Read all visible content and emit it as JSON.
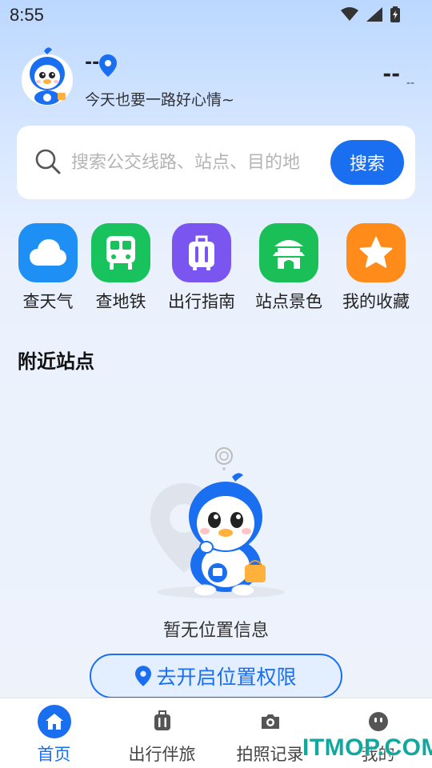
{
  "status_bar": {
    "time": "8:55"
  },
  "header": {
    "user_name": "--",
    "greeting": "今天也要一路好心情~",
    "weather_temp": "--",
    "weather_sub": "--"
  },
  "search": {
    "placeholder": "搜索公交线路、站点、目的地",
    "button_label": "搜索"
  },
  "quick_actions": [
    {
      "label": "查天气",
      "icon": "cloud-icon",
      "color": "#1e8ff5"
    },
    {
      "label": "查地铁",
      "icon": "subway-icon",
      "color": "#18c25c"
    },
    {
      "label": "出行指南",
      "icon": "luggage-icon",
      "color": "#7b55f0"
    },
    {
      "label": "站点景色",
      "icon": "pavilion-icon",
      "color": "#1bbf57"
    },
    {
      "label": "我的收藏",
      "icon": "star-icon",
      "color": "#ff8c1a"
    }
  ],
  "nearby": {
    "title": "附近站点",
    "empty_text": "暂无位置信息",
    "permission_button": "去开启位置权限"
  },
  "bottom_nav": [
    {
      "label": "首页",
      "icon": "home-icon",
      "active": true
    },
    {
      "label": "出行伴旅",
      "icon": "luggage-icon",
      "active": false
    },
    {
      "label": "拍照记录",
      "icon": "camera-icon",
      "active": false
    },
    {
      "label": "我的",
      "icon": "profile-icon",
      "active": false
    }
  ],
  "watermark": "ITMOP.COM",
  "colors": {
    "accent": "#1a6ff0",
    "background": "#eef3fb"
  }
}
